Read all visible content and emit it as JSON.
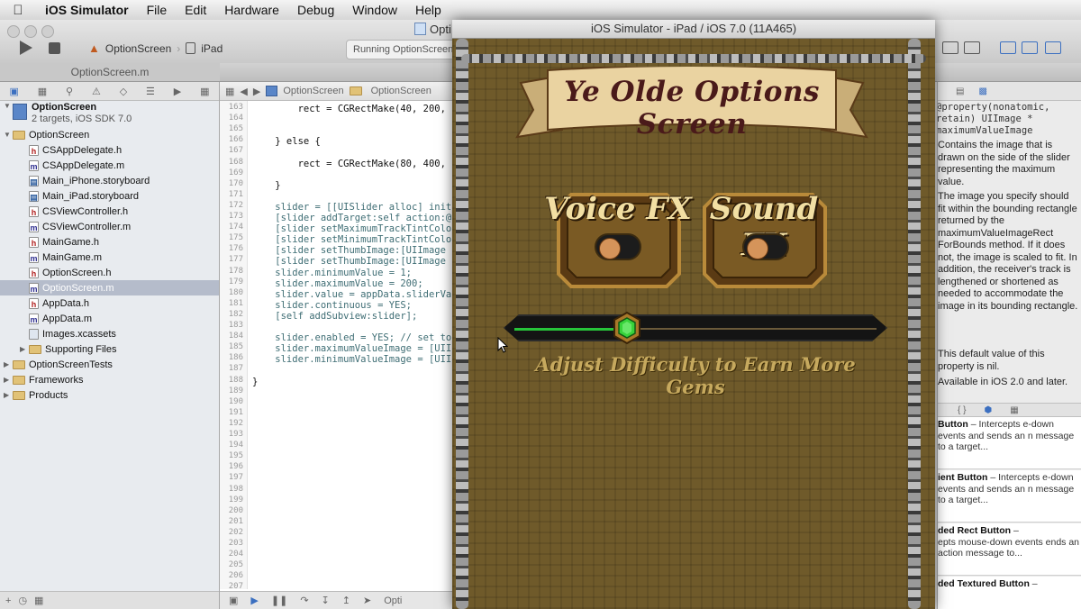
{
  "menubar": {
    "app_name": "iOS Simulator",
    "items": [
      "File",
      "Edit",
      "Hardware",
      "Debug",
      "Window",
      "Help"
    ]
  },
  "xcode": {
    "window_title": "Opti",
    "scheme_target": "OptionScreen",
    "scheme_device": "iPad",
    "activity_text": "Running OptionScreen...",
    "active_tab": "OptionScreen.m",
    "jumpbar": [
      "OptionScreen",
      "OptionScreen"
    ]
  },
  "navigator": {
    "project": {
      "name": "OptionScreen",
      "subtitle": "2 targets, iOS SDK 7.0"
    },
    "rows": [
      {
        "label": "OptionScreen",
        "kind": "folder",
        "indent": 1
      },
      {
        "label": "CSAppDelegate.h",
        "kind": "h",
        "indent": 2
      },
      {
        "label": "CSAppDelegate.m",
        "kind": "m",
        "indent": 2
      },
      {
        "label": "Main_iPhone.storyboard",
        "kind": "sb",
        "indent": 2
      },
      {
        "label": "Main_iPad.storyboard",
        "kind": "sb",
        "indent": 2
      },
      {
        "label": "CSViewController.h",
        "kind": "h",
        "indent": 2
      },
      {
        "label": "CSViewController.m",
        "kind": "m",
        "indent": 2
      },
      {
        "label": "MainGame.h",
        "kind": "h",
        "indent": 2
      },
      {
        "label": "MainGame.m",
        "kind": "m",
        "indent": 2
      },
      {
        "label": "OptionScreen.h",
        "kind": "h",
        "indent": 2
      },
      {
        "label": "OptionScreen.m",
        "kind": "m",
        "indent": 2,
        "selected": true
      },
      {
        "label": "AppData.h",
        "kind": "h",
        "indent": 2
      },
      {
        "label": "AppData.m",
        "kind": "m",
        "indent": 2
      },
      {
        "label": "Images.xcassets",
        "kind": "asset",
        "indent": 2
      },
      {
        "label": "Supporting Files",
        "kind": "folder-collapsed",
        "indent": 2
      },
      {
        "label": "OptionScreenTests",
        "kind": "folder-collapsed",
        "indent": 1
      },
      {
        "label": "Frameworks",
        "kind": "folder-collapsed",
        "indent": 1
      },
      {
        "label": "Products",
        "kind": "folder-collapsed",
        "indent": 1
      }
    ]
  },
  "editor": {
    "line_numbers": [
      "163",
      "164",
      "165",
      "166",
      "167",
      "168",
      "169",
      "170",
      "171",
      "172",
      "173",
      "174",
      "175",
      "176",
      "177",
      "178",
      "179",
      "180",
      "181",
      "182",
      "183",
      "184",
      "185",
      "186",
      "187",
      "188",
      "189",
      "190",
      "191",
      "192",
      "193",
      "194",
      "195",
      "196",
      "197",
      "198",
      "199",
      "200",
      "201",
      "202",
      "203",
      "204",
      "205",
      "206",
      "207",
      "208"
    ],
    "code_lines": [
      {
        "text": "        rect = CGRectMake(40, 200, ",
        "color": "black"
      },
      {
        "text": "",
        "color": "black"
      },
      {
        "text": "",
        "color": "black"
      },
      {
        "text": "    } else {",
        "color": "black"
      },
      {
        "text": "",
        "color": "black"
      },
      {
        "text": "        rect = CGRectMake(80, 400, ",
        "color": "black"
      },
      {
        "text": "",
        "color": "black"
      },
      {
        "text": "    }",
        "color": "black"
      },
      {
        "text": "",
        "color": "black"
      },
      {
        "text": "    slider = [[UISlider alloc] init",
        "color": "teal"
      },
      {
        "text": "    [slider addTarget:self action:@",
        "color": "teal"
      },
      {
        "text": "    [slider setMaximumTrackTintColo",
        "color": "teal"
      },
      {
        "text": "    [slider setMinimumTrackTintColo",
        "color": "teal"
      },
      {
        "text": "    [slider setThumbImage:[UIImage ",
        "color": "teal"
      },
      {
        "text": "    [slider setThumbImage:[UIImage ",
        "color": "teal"
      },
      {
        "text": "    slider.minimumValue = 1;",
        "color": "teal"
      },
      {
        "text": "    slider.maximumValue = 200;",
        "color": "teal"
      },
      {
        "text": "    slider.value = appData.sliderVa",
        "color": "teal"
      },
      {
        "text": "    slider.continuous = YES;",
        "color": "teal"
      },
      {
        "text": "    [self addSubview:slider];",
        "color": "teal"
      },
      {
        "text": "",
        "color": "black"
      },
      {
        "text": "    slider.enabled = YES; // set to",
        "color": "teal"
      },
      {
        "text": "    slider.maximumValueImage = [UII",
        "color": "teal"
      },
      {
        "text": "    slider.minimumValueImage = [UII",
        "color": "teal"
      },
      {
        "text": "",
        "color": "black"
      },
      {
        "text": "}",
        "color": "black"
      }
    ],
    "debug_label": "Opti"
  },
  "simulator": {
    "window_title": "iOS Simulator - iPad / iOS 7.0 (11A465)",
    "banner_title": "Ye Olde Options Screen",
    "voice_label": "Voice FX",
    "sound_label": "Sound FX",
    "voice_on": false,
    "sound_on": false,
    "slider_fraction": 0.31,
    "slider_caption": "Adjust Difficulty to Earn More Gems",
    "colors": {
      "gem": "#37d33a",
      "track_fill": "#27c43a",
      "banner": "#e8d2a0",
      "text_gold": "#c6a95e"
    }
  },
  "inspector": {
    "declaration": "@property(nonatomic,\nretain) UIImage *\nmaximumValueImage",
    "paragraphs": [
      "Contains the image that is drawn on the side of the slider representing the maximum value.",
      "The image you specify should fit within the bounding rectangle returned by the maximumValueImageRect ForBounds method. If it does not, the image is scaled to fit. In addition, the receiver's track is lengthened or shortened as needed to accommodate the image in its bounding rectangle.",
      "This default value of this property is nil.",
      "Available in iOS 2.0 and later."
    ],
    "library": [
      {
        "title": "Button",
        "desc": "Intercepts e-down events and sends an n message to a target..."
      },
      {
        "title": "ient Button",
        "desc": "Intercepts e-down events and sends an n message to a target..."
      },
      {
        "title": "ded Rect Button",
        "desc": "epts mouse-down events ends an action message to..."
      },
      {
        "title": "ded Textured Button",
        "desc": ""
      }
    ]
  }
}
